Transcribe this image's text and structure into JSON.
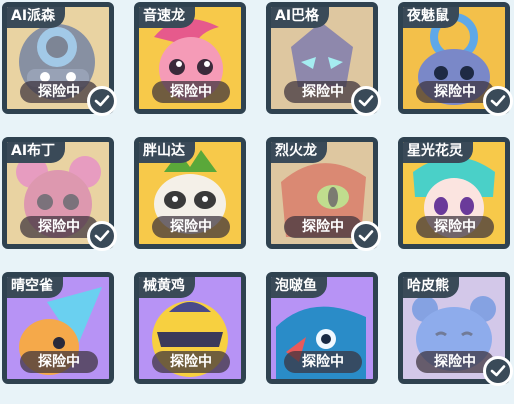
{
  "cards": [
    {
      "name": "AI派森",
      "status": "探险中",
      "selected": true,
      "frame": "#d8a430",
      "bg": "#dcb86a"
    },
    {
      "name": "音速龙",
      "status": "探险中",
      "selected": false,
      "frame": "#e8a525",
      "bg": "#f7c94a"
    },
    {
      "name": "AI巴格",
      "status": "探险中",
      "selected": true,
      "frame": "#d8a430",
      "bg": "#caa566"
    },
    {
      "name": "夜魅鼠",
      "status": "探险中",
      "selected": true,
      "frame": "#e8a525",
      "bg": "#f3c04a"
    },
    {
      "name": "AI布丁",
      "status": "探险中",
      "selected": true,
      "frame": "#d8a430",
      "bg": "#dcb86a"
    },
    {
      "name": "胖山达",
      "status": "探险中",
      "selected": false,
      "frame": "#e8a525",
      "bg": "#f7c94a"
    },
    {
      "name": "烈火龙",
      "status": "探险中",
      "selected": true,
      "frame": "#d8a430",
      "bg": "#caa566"
    },
    {
      "name": "星光花灵",
      "status": "探险中",
      "selected": false,
      "frame": "#e8a525",
      "bg": "#f7c94a"
    },
    {
      "name": "晴空雀",
      "status": "探险中",
      "selected": false,
      "frame": "#a77df0",
      "bg": "#b793f5"
    },
    {
      "name": "械黄鸡",
      "status": "探险中",
      "selected": false,
      "frame": "#a77df0",
      "bg": "#b793f5"
    },
    {
      "name": "泡啵鱼",
      "status": "探险中",
      "selected": false,
      "frame": "#a77df0",
      "bg": "#b793f5"
    },
    {
      "name": "哈皮熊",
      "status": "探险中",
      "selected": true,
      "frame": "#9a86c8",
      "bg": "#b8a6dc"
    }
  ]
}
